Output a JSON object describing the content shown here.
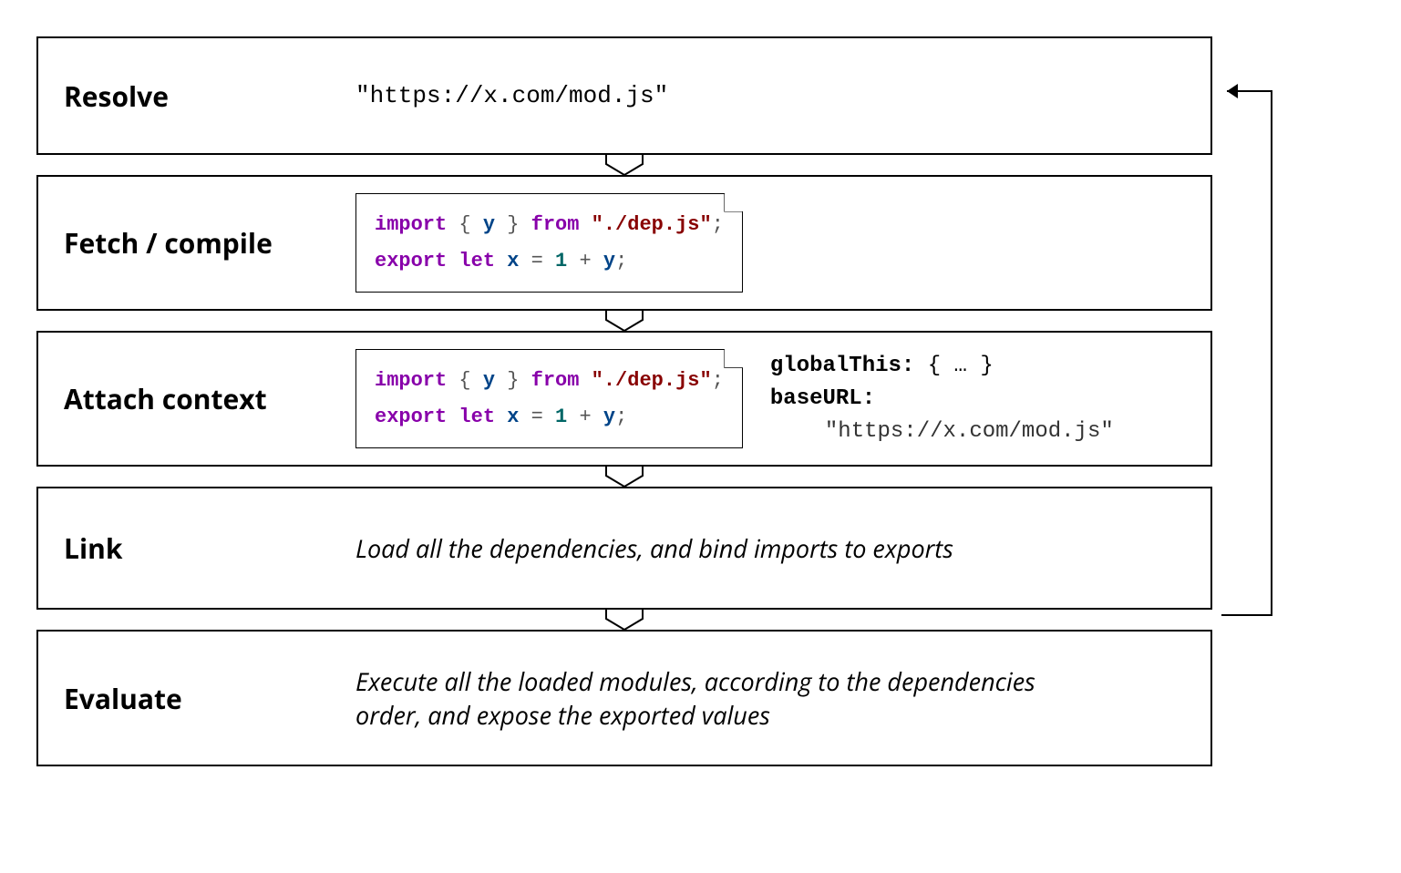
{
  "stages": {
    "resolve": {
      "title": "Resolve",
      "url": "\"https://x.com/mod.js\""
    },
    "fetch": {
      "title": "Fetch / compile",
      "code": {
        "kw_import": "import",
        "brace_open": "{",
        "y1": "y",
        "brace_close": "}",
        "kw_from": "from",
        "dep_str": "\"./dep.js\"",
        "semi1": ";",
        "kw_export": "export",
        "kw_let": "let",
        "x": "x",
        "eq": "=",
        "one": "1",
        "plus": "+",
        "y2": "y",
        "semi2": ";"
      }
    },
    "attach": {
      "title": "Attach context",
      "context": {
        "globalThis_label": "globalThis:",
        "globalThis_value": "{ … }",
        "baseURL_label": "baseURL:",
        "baseURL_value": "\"https://x.com/mod.js\""
      }
    },
    "link": {
      "title": "Link",
      "desc": "Load all the dependencies, and bind imports to exports"
    },
    "evaluate": {
      "title": "Evaluate",
      "desc": "Execute all the loaded modules, according to the dependencies order, and expose the exported values"
    }
  }
}
